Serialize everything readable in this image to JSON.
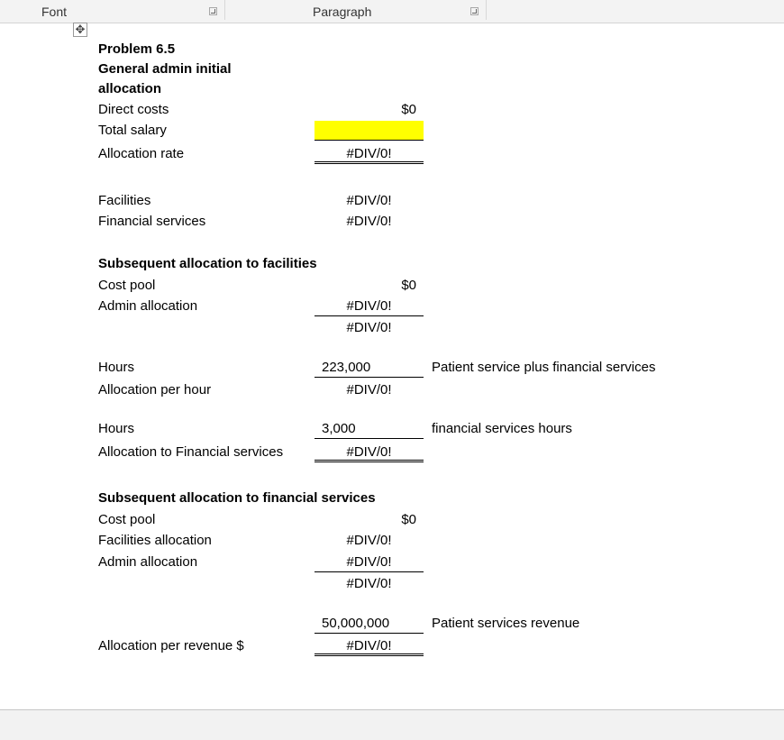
{
  "ribbon": {
    "groups": [
      {
        "label": "Font"
      },
      {
        "label": "Paragraph"
      }
    ]
  },
  "colors": {
    "input_highlight": "#ffff00",
    "ribbon_bg": "#f3f3f3"
  },
  "document": {
    "title": "Problem 6.5",
    "section1": {
      "heading_line1": "General admin initial",
      "heading_line2": "allocation",
      "rows": [
        {
          "label": "Direct costs",
          "value": "$0"
        },
        {
          "label": "Total salary",
          "value": ""
        },
        {
          "label": "Allocation rate",
          "value": "#DIV/0!"
        },
        {
          "label": "Facilities",
          "value": "#DIV/0!"
        },
        {
          "label": "Financial services",
          "value": "#DIV/0!"
        }
      ]
    },
    "section2": {
      "heading": "Subsequent allocation to facilities",
      "rows": [
        {
          "label": "Cost pool",
          "value": "$0"
        },
        {
          "label": "Admin allocation",
          "value": "#DIV/0!"
        },
        {
          "label": "",
          "value": "#DIV/0!"
        },
        {
          "label": "Hours",
          "value": "223,000",
          "note": "Patient service plus financial services"
        },
        {
          "label": "Allocation per hour",
          "value": "#DIV/0!"
        },
        {
          "label": "Hours",
          "value": "3,000",
          "note": "financial services hours"
        },
        {
          "label": "Allocation to Financial services",
          "value": "#DIV/0!"
        }
      ]
    },
    "section3": {
      "heading": "Subsequent allocation to financial services",
      "rows": [
        {
          "label": "Cost pool",
          "value": "$0"
        },
        {
          "label": "Facilities allocation",
          "value": "#DIV/0!"
        },
        {
          "label": "Admin allocation",
          "value": "#DIV/0!"
        },
        {
          "label": "",
          "value": "#DIV/0!"
        },
        {
          "label": "",
          "value": "50,000,000",
          "note": "Patient services revenue"
        },
        {
          "label": "Allocation per revenue $",
          "value": "#DIV/0!"
        }
      ]
    }
  }
}
